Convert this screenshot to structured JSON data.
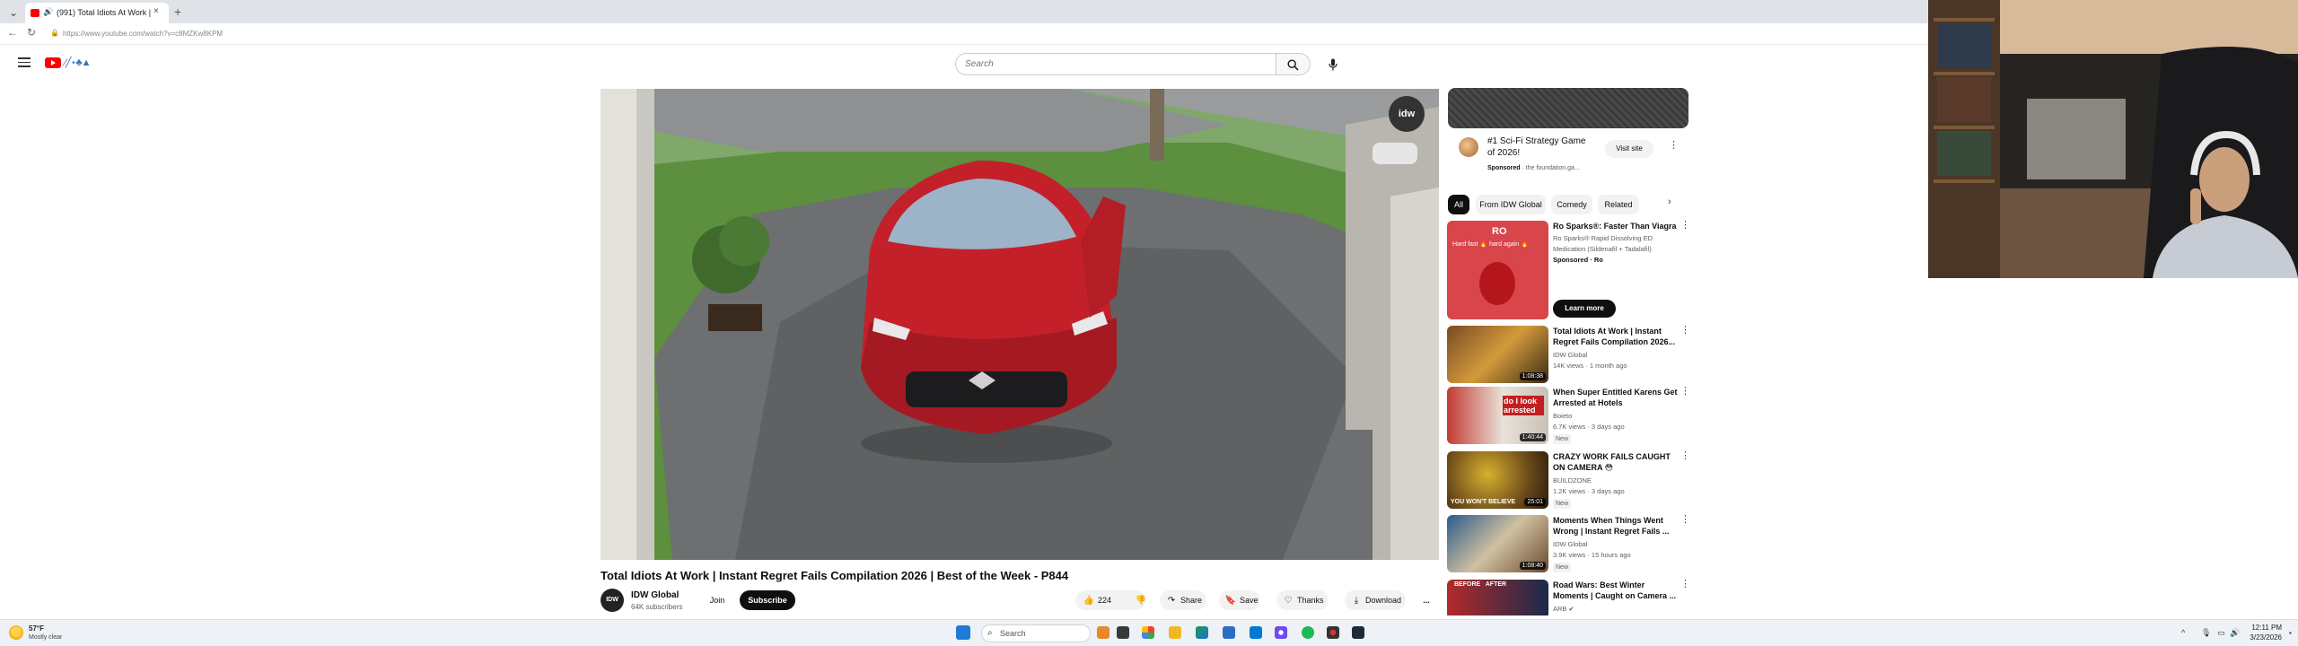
{
  "browser": {
    "tab_title": "(991) Total Idiots At Work | In...",
    "tab_close": "×",
    "new_tab": "+",
    "url": "https://www.youtube.com/watch?v=c8MZKw8KPM"
  },
  "header": {
    "search_placeholder": "Search"
  },
  "video": {
    "watermark": "idw",
    "title": "Total Idiots At Work | Instant Regret Fails Compilation 2026 | Best of the Week - P844",
    "channel_avatar": "IDW",
    "channel_name": "IDW Global",
    "subscribers": "64K subscribers",
    "join_label": "Join",
    "subscribe_label": "Subscribe",
    "like_count": "224",
    "share_label": "Share",
    "save_label": "Save",
    "thanks_label": "Thanks",
    "download_label": "Download",
    "more_label": "..."
  },
  "sidebar": {
    "ad": {
      "title": "#1 Sci-Fi Strategy Game of 2026!",
      "sponsored": "Sponsored",
      "sponsor_source": "· the foundation.ga...",
      "visit_label": "Visit site"
    },
    "chips": [
      "All",
      "From IDW Global",
      "Comedy",
      "Related"
    ],
    "recommendations": [
      {
        "title": "Ro Sparks®: Faster Than Viagra",
        "meta1": "Ro Sparks® Rapid Dissolving ED",
        "meta2": "Medication (Sildenafil + Tadalafil)",
        "meta3": "Sponsored · Ro",
        "thumb_text": "RO",
        "thumb_sub": "Hard fast 🔥 hard again 🔥",
        "cta": "Learn more",
        "duration": "",
        "new": ""
      },
      {
        "title": "Total Idiots At Work | Instant Regret Fails Compilation 2026...",
        "meta1": "IDW Global",
        "meta2": "14K views · 1 month ago",
        "duration": "1:08:38",
        "new": ""
      },
      {
        "title": "When Super Entitled Karens Get Arrested at Hotels",
        "meta1": "Boieto",
        "meta2": "6.7K views · 3 days ago",
        "duration": "1:40:44",
        "thumb_text": "do I look arrested",
        "new": "New"
      },
      {
        "title": "CRAZY WORK FAILS CAUGHT ON CAMERA 😳",
        "meta1": "BUILDZONE",
        "meta2": "1.2K views · 3 days ago",
        "duration": "25:01",
        "thumb_text": "YOU WON'T BELIEVE",
        "new": "New"
      },
      {
        "title": "Moments When Things Went Wrong | Instant Regret Fails ...",
        "meta1": "IDW Global",
        "meta2": "3.9K views · 15 hours ago",
        "duration": "1:08:40",
        "new": "New"
      },
      {
        "title": "Road Wars: Best Winter Moments | Caught on Camera ...",
        "meta1": "ARB ✔",
        "meta2": "",
        "duration": "",
        "thumb_text": "BEFORE   AFTER",
        "new": ""
      }
    ]
  },
  "taskbar": {
    "temperature": "57°F",
    "weather": "Mostly clear",
    "search_placeholder": "Search",
    "time": "12:11 PM",
    "date": "3/23/2026"
  },
  "colors": {
    "youtube_red": "#ff0000",
    "car_red": "#c4202a",
    "subscribe_bg": "#0f0f0f",
    "chip_active": "#0f0f0f"
  }
}
